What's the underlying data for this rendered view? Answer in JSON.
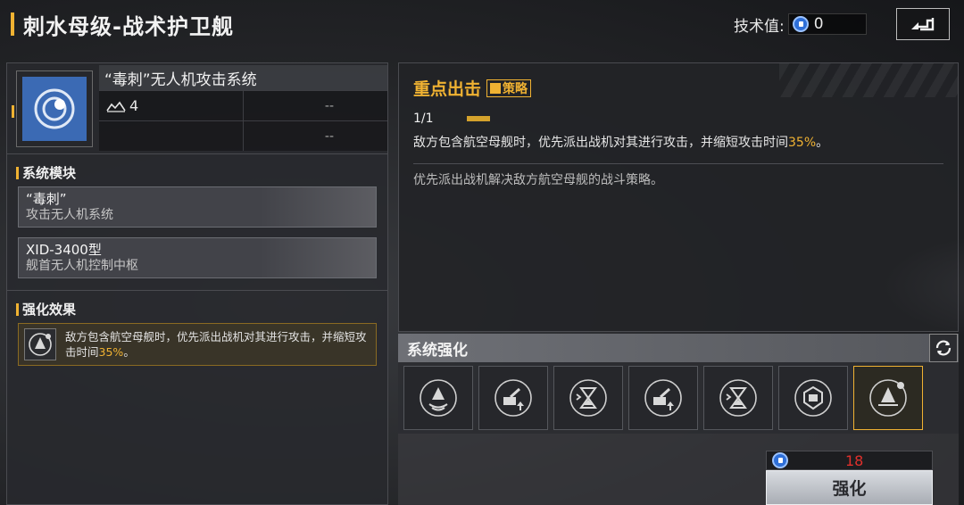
{
  "header": {
    "title": "刺水母级-战术护卫舰"
  },
  "tech": {
    "label": "技术值:",
    "value": "0",
    "icon": "tech-gem-icon"
  },
  "back": {
    "icon": "back-arrow-icon"
  },
  "module": {
    "icon": "crosshair-module-icon",
    "name": "“毒刺”无人机攻击系统",
    "stats": [
      {
        "icon": "level-icon",
        "value": "4",
        "right": "--"
      },
      {
        "icon": "",
        "value": "",
        "right": "--"
      }
    ]
  },
  "systems": {
    "heading": "系统模块",
    "items": [
      {
        "name": "“毒刺”",
        "desc": "攻击无人机系统"
      },
      {
        "name": "XID-3400型",
        "desc": "舰首无人机控制中枢"
      }
    ]
  },
  "effect": {
    "heading": "强化效果",
    "icon": "carrier-strike-icon",
    "text_pre": "敌方包含航空母舰时，优先派出战机对其进行攻击，并缩短攻",
    "text_line2": "击时间",
    "text_pct": "35%",
    "text_end": "。"
  },
  "strategy": {
    "title": "重点出击",
    "badge": "策略",
    "level": "1/1",
    "desc_pre": "敌方包含航空母舰时，优先派出战机对其进行攻击，并缩短攻击时间",
    "desc_pct": "35%",
    "desc_end": "。",
    "sub": "优先派出战机解决敌方航空母舰的战斗策略。"
  },
  "enhance": {
    "heading": "系统强化",
    "refresh_icon": "refresh-icon",
    "slots": [
      {
        "icon": "aircraft-wave-icon",
        "selected": false
      },
      {
        "icon": "cannon-up-icon",
        "selected": false
      },
      {
        "icon": "hourglass-icon",
        "selected": false
      },
      {
        "icon": "cannon-up-icon",
        "selected": false
      },
      {
        "icon": "hourglass-icon",
        "selected": false
      },
      {
        "icon": "shield-drone-icon",
        "selected": false
      },
      {
        "icon": "carrier-strike-icon",
        "selected": true
      }
    ],
    "cost": "18",
    "cost_icon": "tech-gem-icon",
    "button": "强化"
  },
  "colors": {
    "accent": "#f0b232",
    "cost_red": "#e0302c",
    "module_blue": "#3b6ab4"
  }
}
